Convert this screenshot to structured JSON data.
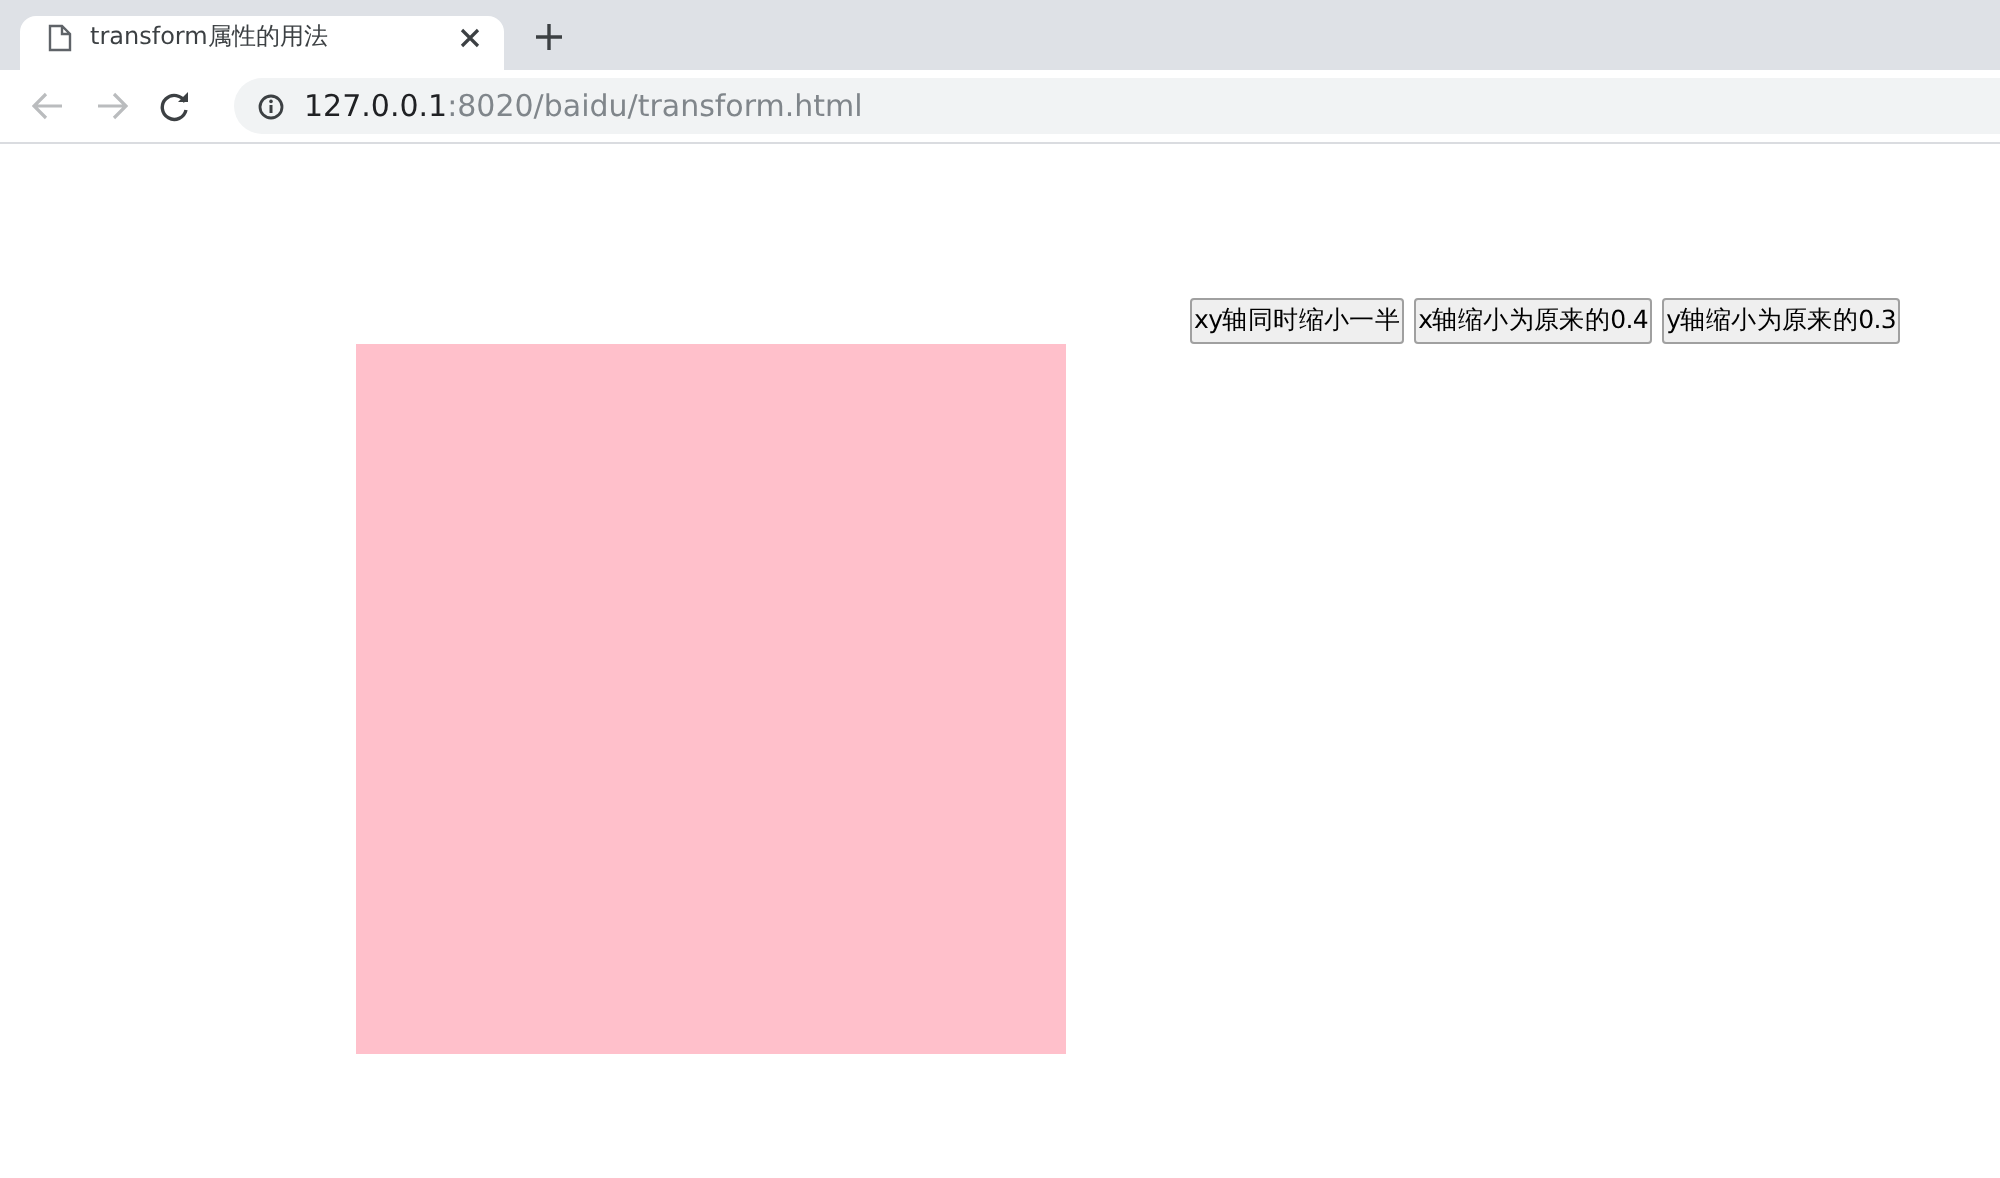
{
  "tab": {
    "title": "transform属性的用法",
    "selected": true
  },
  "address": {
    "host": "127.0.0.1",
    "rest": ":8020/baidu/transform.html"
  },
  "page": {
    "square": {
      "color": "#ffc0cb"
    },
    "buttons": [
      "xy轴同时缩小一半",
      "x轴缩小为原来的0.4",
      "y轴缩小为原来的0.3"
    ]
  }
}
